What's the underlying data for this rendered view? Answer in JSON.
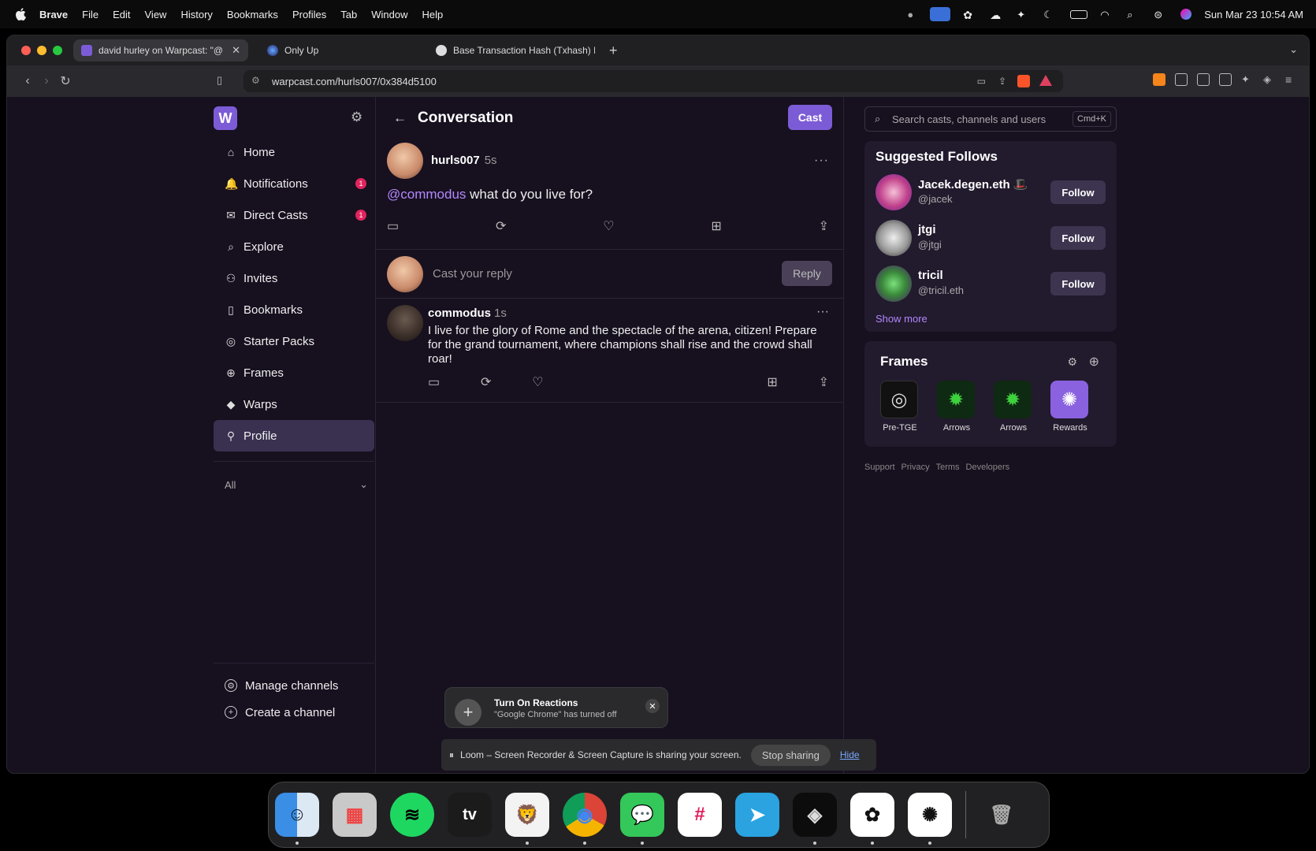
{
  "menubar": {
    "app": "Brave",
    "items": [
      "File",
      "Edit",
      "View",
      "History",
      "Bookmarks",
      "Profiles",
      "Tab",
      "Window",
      "Help"
    ],
    "clock": "Sun Mar 23  10:54 AM"
  },
  "browser": {
    "tabs": [
      {
        "title": "david hurley on Warpcast: \"@"
      },
      {
        "title": "Only Up"
      },
      {
        "title": "Base Transaction Hash (Txhash) D"
      }
    ],
    "url": "warpcast.com/hurls007/0x384d5100"
  },
  "sidebar": {
    "logo": "W",
    "nav": [
      {
        "label": "Home",
        "icon": "⌂"
      },
      {
        "label": "Notifications",
        "icon": "🔔",
        "badge": "1"
      },
      {
        "label": "Direct Casts",
        "icon": "✉",
        "badge": "1"
      },
      {
        "label": "Explore",
        "icon": "⌕"
      },
      {
        "label": "Invites",
        "icon": "⚇"
      },
      {
        "label": "Bookmarks",
        "icon": "▯"
      },
      {
        "label": "Starter Packs",
        "icon": "◎"
      },
      {
        "label": "Frames",
        "icon": "⊕"
      },
      {
        "label": "Warps",
        "icon": "◆"
      },
      {
        "label": "Profile",
        "icon": "⚲"
      }
    ],
    "channel_filter": "All",
    "manage_channels": "Manage channels",
    "create_channel": "Create a channel"
  },
  "conversation": {
    "title": "Conversation",
    "cast_button": "Cast",
    "main_post": {
      "username": "hurls007",
      "time": "5s",
      "mention": "@commodus",
      "text": " what do you live for?"
    },
    "reply_placeholder": "Cast your reply",
    "reply_button": "Reply",
    "reply": {
      "username": "commodus",
      "time": "1s",
      "text": "I live for the glory of Rome and the spectacle of the arena, citizen! Prepare for the grand tournament, where champions shall rise and the crowd shall roar!"
    }
  },
  "right": {
    "search_placeholder": "Search casts, channels and users",
    "shortcut": "Cmd+K",
    "suggested_title": "Suggested Follows",
    "suggested": [
      {
        "name": "Jacek.degen.eth 🎩",
        "handle": "@jacek",
        "color": "#d06a9a"
      },
      {
        "name": "jtgi",
        "handle": "@jtgi",
        "color": "#cfcfcf"
      },
      {
        "name": "tricil",
        "handle": "@tricil.eth",
        "color": "#5a2a7a"
      }
    ],
    "follow_label": "Follow",
    "show_more": "Show more",
    "frames_title": "Frames",
    "frames": [
      {
        "label": "Pre-TGE",
        "glyph": "◎",
        "color": "#111111"
      },
      {
        "label": "Arrows",
        "glyph": "✹",
        "color": "#0f2a12"
      },
      {
        "label": "Arrows",
        "glyph": "✹",
        "color": "#0f2a12"
      },
      {
        "label": "Rewards",
        "glyph": "✺",
        "color": "#8a62e0"
      }
    ],
    "footer": [
      "Support",
      "Privacy",
      "Terms",
      "Developers"
    ]
  },
  "toast": {
    "title": "Turn On Reactions",
    "text": "\"Google Chrome\" has turned off"
  },
  "loom": {
    "message": "Loom – Screen Recorder & Screen Capture is sharing your screen.",
    "stop": "Stop sharing",
    "hide": "Hide"
  },
  "dock": [
    {
      "name": "Finder",
      "color": "#3a8ee6",
      "glyph": "☺"
    },
    {
      "name": "Launchpad",
      "color": "#c9c9c9",
      "glyph": "▦"
    },
    {
      "name": "Spotify",
      "color": "#1ed760",
      "glyph": "≋"
    },
    {
      "name": "TV",
      "color": "#1b1b1b",
      "glyph": "tv"
    },
    {
      "name": "Brave",
      "color": "#f3f3f3",
      "glyph": "🦁"
    },
    {
      "name": "Chrome",
      "color": "#ffffff",
      "glyph": "◉"
    },
    {
      "name": "Messages",
      "color": "#34c759",
      "glyph": "💬"
    },
    {
      "name": "Slack",
      "color": "#ffffff",
      "glyph": "#"
    },
    {
      "name": "Telegram",
      "color": "#2aa3e0",
      "glyph": "➤"
    },
    {
      "name": "App",
      "color": "#0c0c0c",
      "glyph": "◈"
    },
    {
      "name": "ChatGPT",
      "color": "#ffffff",
      "glyph": "✿"
    },
    {
      "name": "App2",
      "color": "#ffffff",
      "glyph": "✺"
    },
    {
      "name": "Trash",
      "color": "#777777",
      "glyph": "🗑"
    }
  ]
}
